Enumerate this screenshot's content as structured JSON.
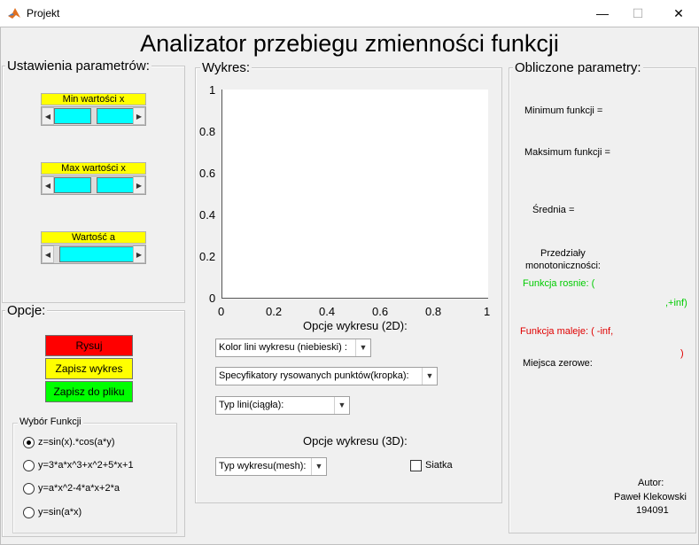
{
  "window": {
    "title": "Projekt",
    "minimize": "—",
    "maximize": "☐",
    "close": "✕"
  },
  "main_title": "Analizator przebiegu zmienności funkcji",
  "settings": {
    "title": "Ustawienia parametrów:",
    "min_x": {
      "label": "Min wartości x"
    },
    "max_x": {
      "label": "Max wartości x"
    },
    "a": {
      "label": "Wartość a"
    }
  },
  "options": {
    "title": "Opcje:",
    "draw_button": "Rysuj",
    "save_plot_button": "Zapisz wykres",
    "save_file_button": "Zapisz do pliku",
    "function_group": {
      "title": "Wybór Funkcji",
      "items": [
        {
          "label": "z=sin(x).*cos(a*y)",
          "checked": true
        },
        {
          "label": "y=3*a*x^3+x^2+5*x+1",
          "checked": false
        },
        {
          "label": "y=a*x^2-4*a*x+2*a",
          "checked": false
        },
        {
          "label": "y=sin(a*x)",
          "checked": false
        }
      ]
    }
  },
  "plot": {
    "title": "Wykres:",
    "y_ticks": [
      "1",
      "0.8",
      "0.6",
      "0.4",
      "0.2",
      "0"
    ],
    "x_ticks": [
      "0",
      "0.2",
      "0.4",
      "0.6",
      "0.8",
      "1"
    ],
    "options_2d_title": "Opcje wykresu (2D):",
    "line_color_dropdown": "Kolor lini wykresu (niebieski) :",
    "marker_dropdown": "Specyfikatory rysowanych punktów(kropka):",
    "line_type_dropdown": "Typ lini(ciągła):",
    "options_3d_title": "Opcje wykresu (3D):",
    "plot_type_dropdown": "Typ wykresu(mesh):",
    "grid_label": "Siatka"
  },
  "results": {
    "title": "Obliczone parametry:",
    "min_label": "Minimum funkcji =",
    "max_label": "Maksimum funkcji =",
    "mean_label": "Średnia =",
    "intervals_line1": "Przedziały",
    "intervals_line2": "monotoniczności:",
    "increasing_label": "Funkcja rosnie: (",
    "increasing_end": ",+inf)",
    "decreasing_label": "Funkcja maleje: ( -inf,",
    "decreasing_end": ")",
    "zeros_label": "Miejsca zerowe:",
    "author_line1": "Autor:",
    "author_line2": "Paweł Klekowski",
    "author_line3": "194091"
  },
  "colors": {
    "draw": "#ff0000",
    "save_plot": "#ffff00",
    "save_file": "#00ff00",
    "increasing": "#00cc00",
    "decreasing": "#e00000",
    "label_bg": "#ffff00",
    "slider_thumb": "#00ffff"
  }
}
